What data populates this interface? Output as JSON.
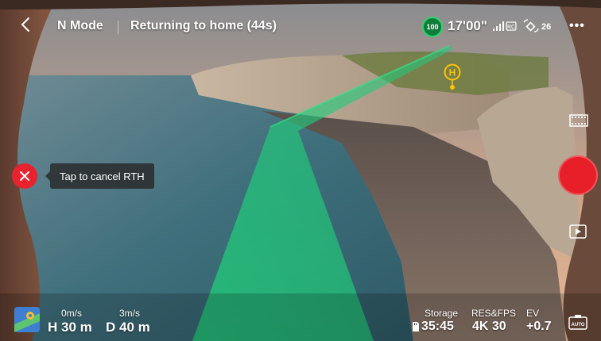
{
  "header": {
    "flight_mode": "N Mode",
    "status": "Returning to home (44s)",
    "battery_percent": "100",
    "flight_time": "17'00\"",
    "rc_label": "RC",
    "satellite_count": "26",
    "more_label": "•••"
  },
  "rth": {
    "tooltip": "Tap to cancel RTH"
  },
  "home_point": {
    "label": "H"
  },
  "telemetry": {
    "horizontal_speed": "0m/s",
    "vertical_speed": "3m/s",
    "height": "H 30 m",
    "distance": "D 40 m"
  },
  "camera": {
    "storage_label": "Storage",
    "storage_value": "35:45",
    "res_label": "RES&FPS",
    "res_value": "4K 30",
    "ev_label": "EV",
    "ev_value": "+0.7",
    "auto_label": "AUTO"
  },
  "colors": {
    "accent_green": "#2ed46c",
    "home_yellow": "#ffc400",
    "shutter_red": "#e81e28"
  }
}
